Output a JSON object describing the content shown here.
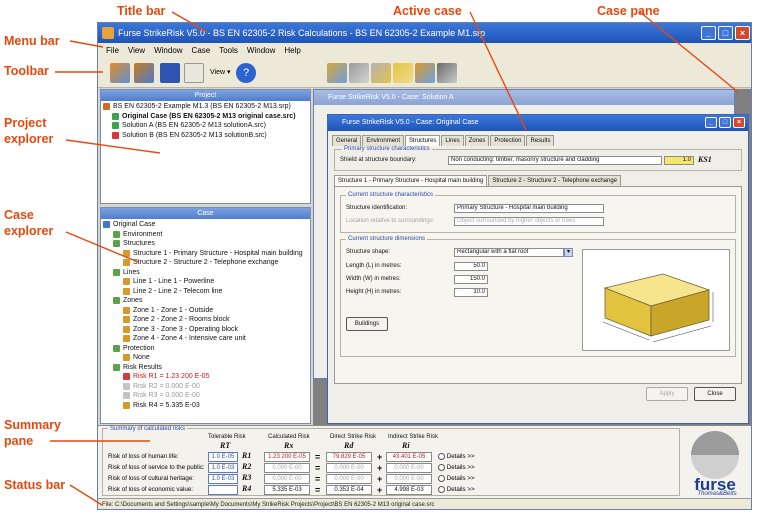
{
  "callouts": {
    "title_bar": "Title bar",
    "active_case": "Active case",
    "case_pane": "Case pane",
    "menu_bar": "Menu bar",
    "toolbar": "Toolbar",
    "project_explorer_1": "Project",
    "project_explorer_2": "explorer",
    "case_explorer_1": "Case",
    "case_explorer_2": "explorer",
    "summary_pane_1": "Summary",
    "summary_pane_2": "pane",
    "status_bar": "Status bar"
  },
  "colors": {
    "callout": "#e8480e",
    "title_blue": "#1f53b8",
    "brand": "#1d3e8e"
  },
  "app": {
    "title": "Furse StrikeRisk V5.0 - BS EN 62305-2 Risk Calculations - BS EN 62305-2 Example M1.srp",
    "menu": [
      "File",
      "View",
      "Window",
      "Case",
      "Tools",
      "Window",
      "Help"
    ],
    "toolbar_view_label": "View"
  },
  "project": {
    "header": "Project",
    "items": [
      {
        "label": "BS EN 62305-2 Example M1.3 (BS EN 62305-2 M13.srp)",
        "style": "normal"
      },
      {
        "label": "Original Case (BS EN 62305-2 M13 original case.src)",
        "style": "bold"
      },
      {
        "label": "Solution A (BS EN 62305-2 M13 solutionA.src)",
        "style": "normal"
      },
      {
        "label": "Solution B (BS EN 62305-2 M13 solutionB.src)",
        "style": "normal"
      }
    ]
  },
  "case_tree": {
    "header": "Case",
    "items": [
      {
        "label": "Original Case",
        "indent": 0,
        "style": "normal"
      },
      {
        "label": "Environment",
        "indent": 1,
        "style": "normal"
      },
      {
        "label": "Structures",
        "indent": 1,
        "style": "normal"
      },
      {
        "label": "Structure 1 - Primary Structure - Hospital main building",
        "indent": 2,
        "style": "normal"
      },
      {
        "label": "Structure 2 - Structure 2 - Telephone exchange",
        "indent": 2,
        "style": "normal"
      },
      {
        "label": "Lines",
        "indent": 1,
        "style": "normal"
      },
      {
        "label": "Line 1 - Line 1 - Powerline",
        "indent": 2,
        "style": "normal"
      },
      {
        "label": "Line 2 - Line 2 - Telecom line",
        "indent": 2,
        "style": "normal"
      },
      {
        "label": "Zones",
        "indent": 1,
        "style": "normal"
      },
      {
        "label": "Zone 1 - Zone 1 - Outside",
        "indent": 2,
        "style": "normal"
      },
      {
        "label": "Zone 2 - Zone 2 - Rooms block",
        "indent": 2,
        "style": "normal"
      },
      {
        "label": "Zone 3 - Zone 3 - Operating block",
        "indent": 2,
        "style": "normal"
      },
      {
        "label": "Zone 4 - Zone 4 - Intensive care unit",
        "indent": 2,
        "style": "normal"
      },
      {
        "label": "Protection",
        "indent": 1,
        "style": "normal"
      },
      {
        "label": "None",
        "indent": 2,
        "style": "normal"
      },
      {
        "label": "Risk Results",
        "indent": 1,
        "style": "normal"
      },
      {
        "label": "Risk R1 = 1.23 200 E-05",
        "indent": 2,
        "style": "red"
      },
      {
        "label": "Risk R2 = 0.000 E-00",
        "indent": 2,
        "style": "grey"
      },
      {
        "label": "Risk R3 = 0.000 E-00",
        "indent": 2,
        "style": "grey"
      },
      {
        "label": "Risk R4 = 5.335 E-03",
        "indent": 2,
        "style": "normal"
      }
    ]
  },
  "case_back": {
    "title": "Furse StrikeRisk V5.0 - Case: Solution A"
  },
  "case_front": {
    "title": "Furse StrikeRisk V5.0 - Case: Original Case",
    "tabs": [
      "General",
      "Environment",
      "Structures",
      "Lines",
      "Zones",
      "Protection",
      "Results"
    ],
    "active_tab": "Structures",
    "primary_group": "Primary structure characteristics",
    "boundary_label": "Shield at structure boundary:",
    "boundary_value": "Non conducting: timber, masonry structure and cladding",
    "ks1_value": "1.0",
    "ks1_symbol": "KS1",
    "subtabs": [
      "Structure 1 - Primary Structure - Hospital main building",
      "Structure 2 - Structure 2 - Telephone exchange"
    ],
    "current_group": "Current structure characteristics",
    "ident_label": "Structure identification:",
    "ident_value": "Primary Structure - Hospital main building",
    "location_label": "Location relative to surroundings:",
    "location_value": "Object surrounded by higher objects or trees",
    "dims_group": "Current structure dimensions",
    "shape_label": "Structure shape:",
    "shape_value": "Rectangular with a flat roof",
    "length_label": "Length (L) in metres:",
    "length_value": "50.0",
    "width_label": "Width (W) in metres:",
    "width_value": "150.0",
    "height_label": "Height (H) in metres:",
    "height_value": "10.0",
    "buildings_btn": "Buildings",
    "apply_btn": "Apply",
    "close_btn": "Close"
  },
  "summary": {
    "title": "Summary of calculated risks",
    "col_tolerable": "Tolerable Risk",
    "col_calculated": "Calculated Risk",
    "col_direct": "Direct Strike Risk",
    "col_indirect": "Indirect Strike Risk",
    "sym_tolerable": "RT",
    "sym_calculated": "Rx",
    "sym_direct": "Rd",
    "sym_indirect": "Ri",
    "details_label": "Details >>",
    "rows": [
      {
        "label": "Risk of loss of human life:",
        "tolerable": "1.0 E-05",
        "sym": "R1",
        "calc": "1.23 200 E-05",
        "direct": "79.829 E-05",
        "indirect": "43.401 E-05",
        "style": "red"
      },
      {
        "label": "Risk of loss of service to the public:",
        "tolerable": "1.0 E-03",
        "sym": "R2",
        "calc": "0.000 E-00",
        "direct": "0.000 E-00",
        "indirect": "0.000 E-00",
        "style": "grey"
      },
      {
        "label": "Risk of loss of cultural heritage:",
        "tolerable": "1.0 E-03",
        "sym": "R3",
        "calc": "0.000 E-00",
        "direct": "0.000 E-00",
        "indirect": "0.000 E-00",
        "style": "grey"
      },
      {
        "label": "Risk of loss of economic value:",
        "tolerable": "",
        "sym": "R4",
        "calc": "5.335 E-03",
        "direct": "0.353 E-04",
        "indirect": "4.998 E-03",
        "style": "normal"
      }
    ]
  },
  "logo": {
    "brand": "furse",
    "tagline": "Thomas&Betts"
  },
  "status": "File: C:\\Documents and Settings\\sample\\My Documents\\My StrikeRisk Projects\\Project\\BS EN 62305-2 M13 original case.src"
}
